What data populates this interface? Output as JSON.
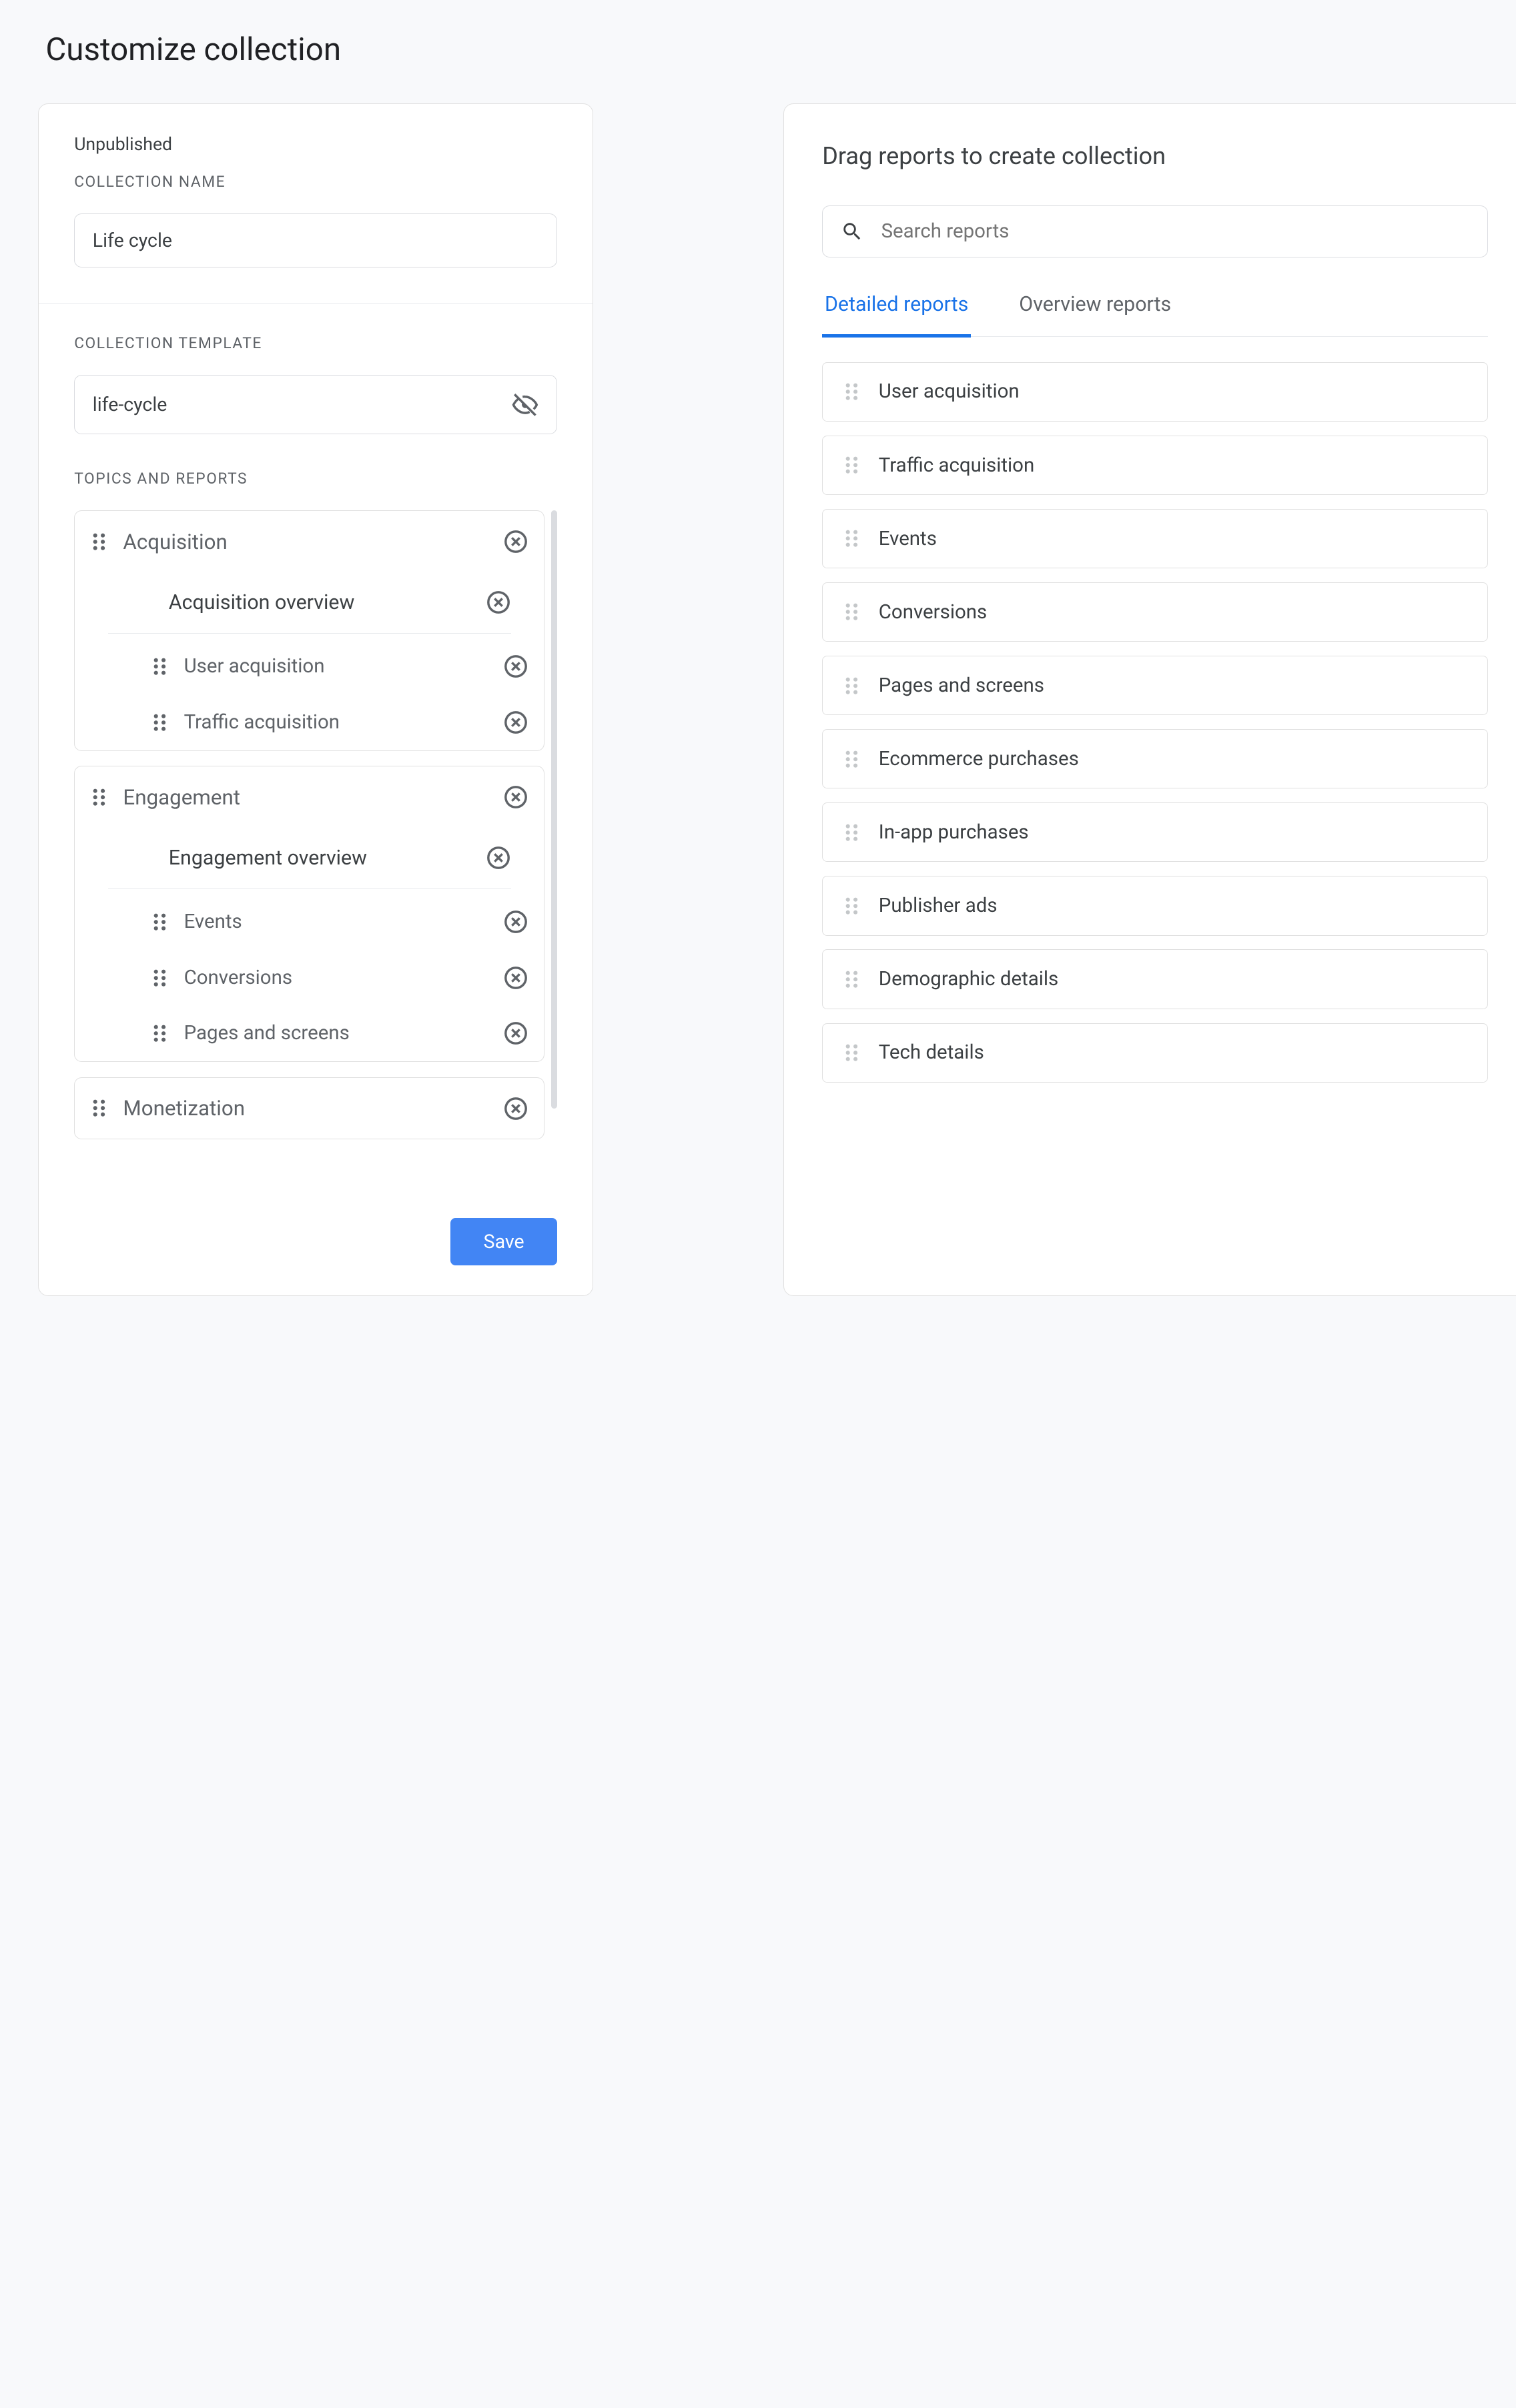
{
  "pageTitle": "Customize collection",
  "left": {
    "status": "Unpublished",
    "collectionNameLabel": "COLLECTION NAME",
    "collectionName": "Life cycle",
    "collectionTemplateLabel": "COLLECTION TEMPLATE",
    "collectionTemplate": "life-cycle",
    "topicsLabel": "TOPICS AND REPORTS",
    "topics": [
      {
        "name": "Acquisition",
        "overview": "Acquisition overview",
        "reports": [
          "User acquisition",
          "Traffic acquisition"
        ]
      },
      {
        "name": "Engagement",
        "overview": "Engagement overview",
        "reports": [
          "Events",
          "Conversions",
          "Pages and screens"
        ]
      },
      {
        "name": "Monetization",
        "overview": null,
        "reports": []
      }
    ],
    "saveLabel": "Save"
  },
  "right": {
    "title": "Drag reports to create collection",
    "searchPlaceholder": "Search reports",
    "tabs": [
      "Detailed reports",
      "Overview reports"
    ],
    "activeTab": 0,
    "reports": [
      "User acquisition",
      "Traffic acquisition",
      "Events",
      "Conversions",
      "Pages and screens",
      "Ecommerce purchases",
      "In-app purchases",
      "Publisher ads",
      "Demographic details",
      "Tech details"
    ]
  }
}
